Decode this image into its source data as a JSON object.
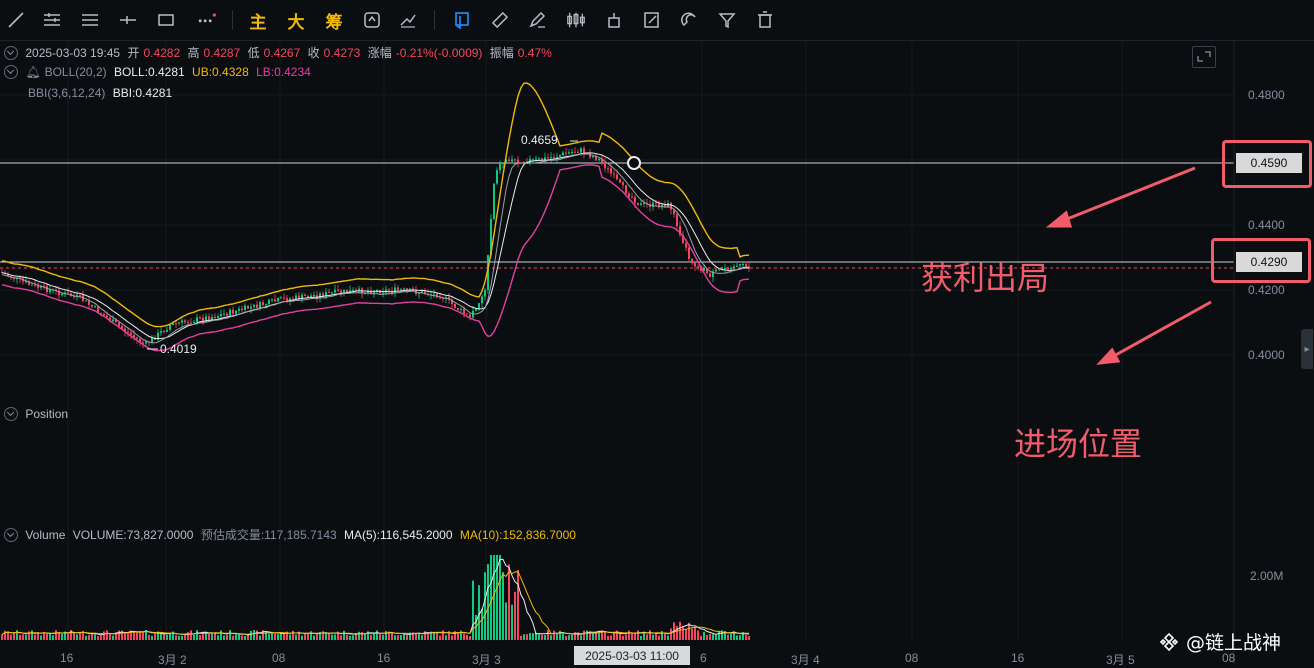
{
  "toolbar": {
    "text_buttons": [
      "主",
      "大",
      "筹"
    ]
  },
  "ohlc": {
    "datetime": "2025-03-03 19:45",
    "open_label": "开",
    "open": "0.4282",
    "high_label": "高",
    "high": "0.4287",
    "low_label": "低",
    "low": "0.4267",
    "close_label": "收",
    "close": "0.4273",
    "change_label": "涨幅",
    "change": "-0.21%(-0.0009)",
    "amplitude_label": "振幅",
    "amplitude": "0.47%"
  },
  "boll": {
    "name": "BOLL(20,2)",
    "mid": "BOLL:0.4281",
    "ub": "UB:0.4328",
    "lb": "LB:0.4234"
  },
  "bbi": {
    "name": "BBI(3,6,12,24)",
    "value": "BBI:0.4281"
  },
  "position": {
    "label": "Position"
  },
  "volume": {
    "label": "Volume",
    "value": "VOLUME:73,827.0000",
    "est_label": "预估成交量:117,185.7143",
    "ma5": "MA(5):116,545.2000",
    "ma10": "MA(10):152,836.7000"
  },
  "price_axis": [
    "0.4800",
    "0.4400",
    "0.4200",
    "0.4000"
  ],
  "volume_axis": [
    "2.00M"
  ],
  "price_tags": [
    "0.4590",
    "0.4290"
  ],
  "chart_labels": {
    "high_marker": "0.4659",
    "low_marker": "0.4019"
  },
  "time_axis": [
    "16",
    "3月 2",
    "08",
    "16",
    "3月 3",
    "6",
    "3月 4",
    "08",
    "16",
    "3月 5",
    "08"
  ],
  "crosshair_time": "2025-03-03 11:00",
  "annotations": {
    "take_profit": "获利出局",
    "entry": "进场位置"
  },
  "watermark": "@链上战神",
  "colors": {
    "up": "#0ecb81",
    "down": "#f6465d",
    "boll_upper": "#f0b90b",
    "boll_lower": "#e040a0",
    "accent_annotation": "#f25c6a"
  }
}
